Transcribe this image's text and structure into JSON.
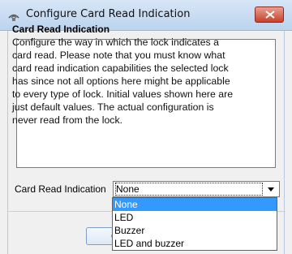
{
  "window": {
    "title": "Configure Card Read Indication"
  },
  "info": {
    "heading": "Card Read Indication",
    "lines": [
      "Configure the way in which the lock indicates a",
      "card read. Please note that you must know what",
      "card read indication capabilities the selected lock",
      "has since not all options here might be applicable",
      "to every type of lock. Initial values shown here are",
      "just default values. The actual configuration is",
      "never read from the lock."
    ]
  },
  "field": {
    "label": "Card Read Indication",
    "selected_value": "None"
  },
  "ok_button": {
    "partial_label": "O"
  },
  "dropdown": {
    "options": [
      "None",
      "LED",
      "Buzzer",
      "LED and buzzer"
    ],
    "selected_index": 0
  },
  "colors": {
    "selection": "#3399ff",
    "close_button": "#c7412b",
    "titlebar": "#bcd3ee"
  },
  "icons": {
    "title_icon": "card-reader-icon",
    "close": "close-icon",
    "combo_arrow": "chevron-down-icon"
  }
}
